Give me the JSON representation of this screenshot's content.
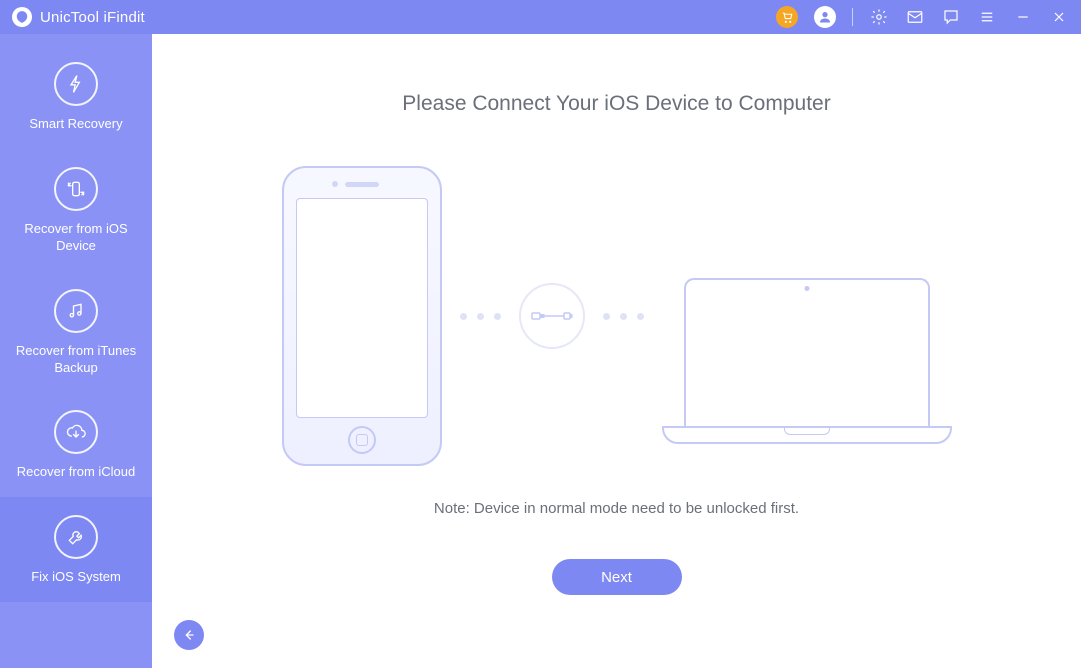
{
  "app": {
    "title": "UnicTool iFindit"
  },
  "sidebar": {
    "items": [
      {
        "label": "Smart Recovery"
      },
      {
        "label": "Recover from iOS Device"
      },
      {
        "label": "Recover from iTunes Backup"
      },
      {
        "label": "Recover from iCloud"
      },
      {
        "label": "Fix iOS System"
      }
    ]
  },
  "main": {
    "heading": "Please Connect Your iOS Device to Computer",
    "note": "Note: Device in normal mode need to be unlocked first.",
    "next_label": "Next"
  }
}
